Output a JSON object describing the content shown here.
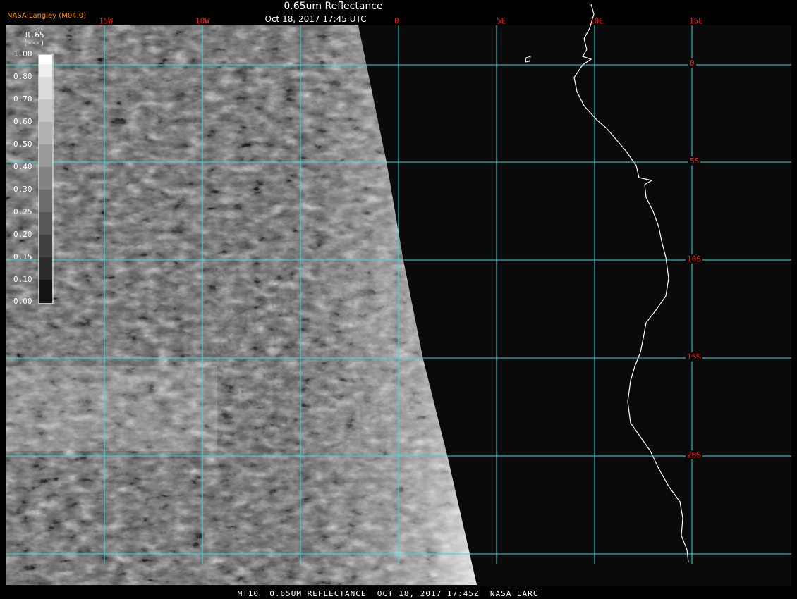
{
  "header": {
    "title": "0.65um Reflectance",
    "subtitle": "Oct 18, 2017 17:45 UTC",
    "credit": "NASA Langley (M04.0)"
  },
  "footer": {
    "caption": "MT10  0.65UM REFLECTANCE  OCT 18, 2017 17:45Z  NASA LARC"
  },
  "legend": {
    "title": "R.65",
    "unit": "(---)",
    "labels": [
      "1.00",
      "0.80",
      "0.70",
      "0.60",
      "0.50",
      "0.40",
      "0.30",
      "0.25",
      "0.20",
      "0.15",
      "0.10",
      "0.00"
    ]
  },
  "axes": {
    "longitude_labels": [
      "15W",
      "10W",
      "0",
      "5E",
      "10E",
      "15E"
    ],
    "latitude_labels": [
      "0",
      "5S",
      "10S",
      "15S",
      "20S"
    ]
  },
  "colors": {
    "grid": "#33dddd",
    "axis_label": "#ff2020",
    "credit": "#ff9900",
    "coastline": "#ffffff",
    "background": "#000000"
  }
}
